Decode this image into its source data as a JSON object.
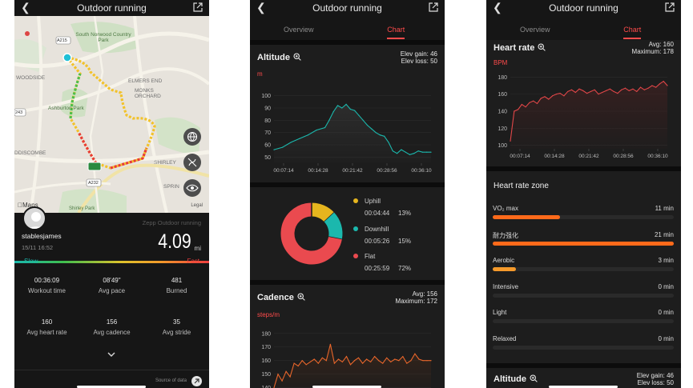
{
  "screen1": {
    "title": "Outdoor running",
    "map_labels": {
      "south_norwood": "South Norwood Country Park",
      "woodside": "WOODSIDE",
      "ashburton": "Ashburton Park",
      "monks": "MONKS ORCHARD",
      "elmers": "ELMERS END",
      "shirley": "SHIRLEY",
      "addiscombe": "DDISCOMBE",
      "spring": "SPRIN",
      "shirley_park": "Shirley Park",
      "road_a215": "A215",
      "road_243": "243",
      "road_232": "A232",
      "maps_brand": "Maps",
      "legal": "Legal"
    },
    "workout_label": "Zepp Outdoor running",
    "username": "stablesjames",
    "datetime": "15/11 16:52",
    "distance": "4.09",
    "distance_unit": "mi",
    "pace_slow": "Slow",
    "pace_fast": "Fast",
    "stats": [
      {
        "value": "00:36:09",
        "label": "Workout time"
      },
      {
        "value": "08'49\"",
        "label": "Avg pace"
      },
      {
        "value": "481",
        "label": "Burned"
      },
      {
        "value": "160",
        "label": "Avg heart rate"
      },
      {
        "value": "156",
        "label": "Avg cadence"
      },
      {
        "value": "35",
        "label": "Avg stride"
      }
    ],
    "expand_icon": "chevron-down-icon",
    "source_label": "Source of data"
  },
  "screen2": {
    "title": "Outdoor running",
    "tabs": [
      "Overview",
      "Chart"
    ],
    "active_tab": "Chart",
    "altitude": {
      "title": "Altitude",
      "gain": "Elev gain: 46",
      "loss": "Elev loss: 50",
      "unit": "m"
    },
    "slope": [
      {
        "name": "Uphill",
        "time": "00:04:44",
        "pct": "13%",
        "value": 13,
        "color": "#e6b51e"
      },
      {
        "name": "Downhill",
        "time": "00:05:26",
        "pct": "15%",
        "value": 15,
        "color": "#1bb8ad"
      },
      {
        "name": "Flat",
        "time": "00:25:59",
        "pct": "72%",
        "value": 72,
        "color": "#ea4a4f"
      }
    ],
    "cadence": {
      "title": "Cadence",
      "avg": "Avg: 156",
      "max": "Maximum: 172",
      "unit": "steps/m"
    }
  },
  "screen3": {
    "title": "Outdoor running",
    "tabs": [
      "Overview",
      "Chart"
    ],
    "active_tab": "Chart",
    "heart_rate": {
      "title": "Heart rate",
      "avg": "Avg: 160",
      "max": "Maximum: 178",
      "unit": "BPM"
    },
    "zone_title": "Heart rate zone",
    "zones": [
      {
        "name": "VO₂ max",
        "time": "11 min",
        "fraction": 0.37,
        "color": "#ff6a1a"
      },
      {
        "name": "耐力强化",
        "time": "21 min",
        "fraction": 1.0,
        "color": "#ff6a1a"
      },
      {
        "name": "Aerobic",
        "time": "3 min",
        "fraction": 0.13,
        "color": "#f59a2b"
      },
      {
        "name": "Intensive",
        "time": "0 min",
        "fraction": 0,
        "color": "#f59a2b"
      },
      {
        "name": "Light",
        "time": "0 min",
        "fraction": 0,
        "color": "#f59a2b"
      },
      {
        "name": "Relaxed",
        "time": "0 min",
        "fraction": 0,
        "color": "#f59a2b"
      }
    ],
    "altitude2": {
      "title": "Altitude",
      "gain": "Elev gain: 46",
      "loss": "Elev loss: 50"
    }
  },
  "chart_data": [
    {
      "type": "area",
      "title": "Altitude",
      "ylabel": "m",
      "x_ticks": [
        "00:07:14",
        "00:14:28",
        "00:21:42",
        "00:28:56",
        "00:36:10"
      ],
      "y_ticks": [
        50,
        60,
        70,
        80,
        90,
        100
      ],
      "ylim": [
        45,
        105
      ],
      "x_minutes": [
        0,
        2,
        4,
        6,
        8,
        10,
        12,
        13,
        14,
        15,
        16,
        17,
        18,
        19,
        20,
        21,
        22,
        23,
        24,
        25,
        26,
        27,
        28,
        29,
        30,
        31,
        32,
        33,
        34,
        35,
        36,
        37
      ],
      "values": [
        56,
        58,
        62,
        65,
        68,
        72,
        74,
        80,
        87,
        92,
        90,
        93,
        89,
        88,
        84,
        80,
        76,
        73,
        70,
        68,
        67,
        62,
        55,
        53,
        56,
        54,
        52,
        53,
        55,
        54,
        54,
        54
      ],
      "color": "#1bb8ad"
    },
    {
      "type": "pie",
      "categories": [
        "Uphill",
        "Downhill",
        "Flat"
      ],
      "values": [
        13,
        15,
        72
      ]
    },
    {
      "type": "area",
      "title": "Cadence",
      "ylabel": "steps/m",
      "y_ticks": [
        140,
        150,
        160,
        170,
        180
      ],
      "ylim": [
        138,
        184
      ],
      "values": [
        140,
        150,
        145,
        152,
        148,
        158,
        156,
        160,
        157,
        159,
        161,
        158,
        162,
        160,
        172,
        158,
        161,
        159,
        163,
        157,
        160,
        162,
        158,
        161,
        159,
        163,
        160,
        158,
        162,
        159,
        161,
        160,
        163,
        158,
        160,
        165,
        161,
        160,
        160,
        160
      ],
      "color": "#e8662b"
    },
    {
      "type": "area",
      "title": "Heart rate",
      "ylabel": "BPM",
      "x_ticks": [
        "00:07:14",
        "00:14:28",
        "00:21:42",
        "00:28:56",
        "00:36:10"
      ],
      "y_ticks": [
        100,
        120,
        140,
        160,
        180
      ],
      "ylim": [
        96,
        184
      ],
      "values": [
        105,
        140,
        142,
        148,
        145,
        150,
        152,
        149,
        155,
        157,
        154,
        158,
        160,
        161,
        158,
        163,
        165,
        162,
        166,
        164,
        161,
        163,
        165,
        160,
        162,
        164,
        166,
        163,
        161,
        165,
        167,
        164,
        166,
        163,
        168,
        165,
        167,
        170,
        168,
        172,
        175,
        170
      ],
      "color": "#e04648"
    }
  ]
}
